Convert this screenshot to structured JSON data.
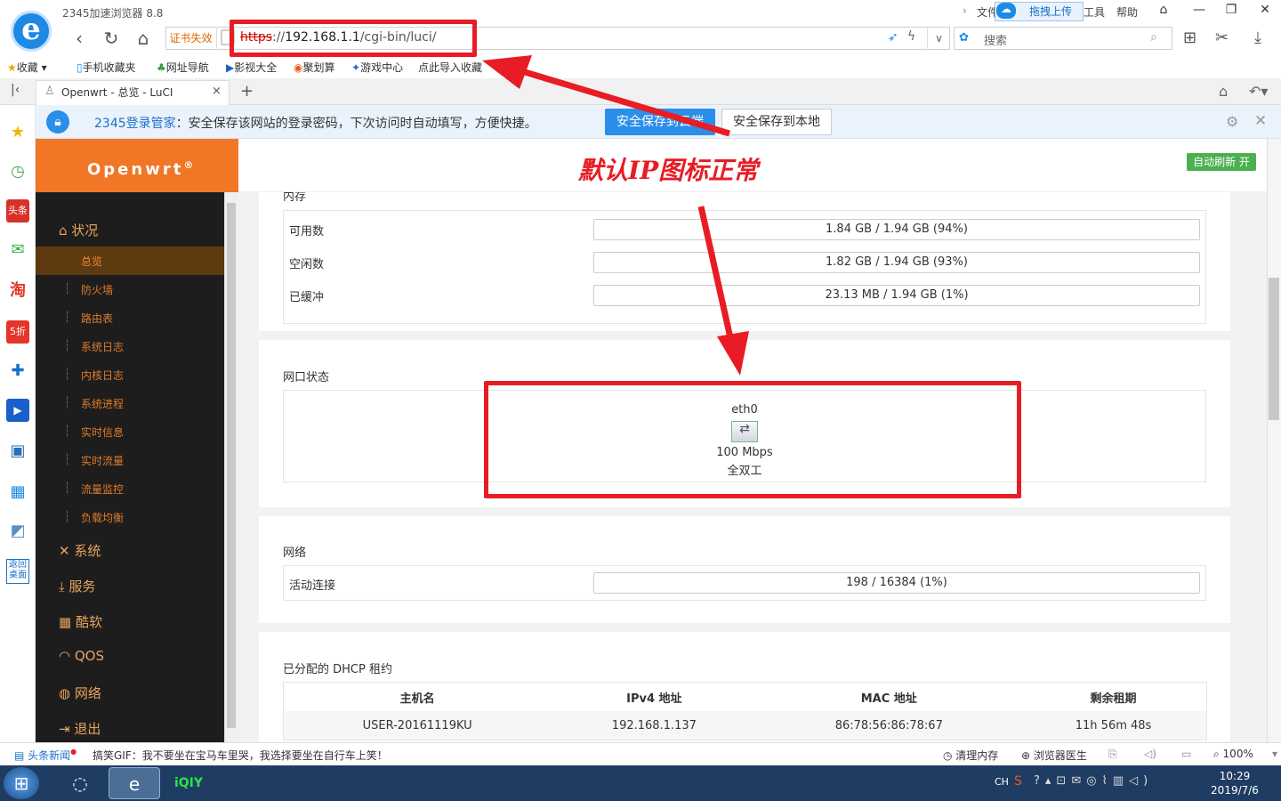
{
  "browser": {
    "title": "2345加速浏览器 8.8",
    "menu": {
      "file": "文件",
      "upload": "拖拽上传",
      "tools": "工具",
      "help": "帮助"
    },
    "cert_warning": "证书失效",
    "url_scheme": "https",
    "url_sep": "://",
    "url_host": "192.168.1.1",
    "url_path": "/cgi-bin/luci/",
    "search_placeholder": "搜索"
  },
  "bookmarks": [
    "收藏",
    "手机收藏夹",
    "网址导航",
    "影视大全",
    "聚划算",
    "游戏中心",
    "点此导入收藏"
  ],
  "tab": {
    "label": "Openwrt - 总览 - LuCI",
    "close": "×",
    "new": "+"
  },
  "password_bar": {
    "brand": "2345登录管家",
    "message": "：安全保存该网站的登录密码，下次访问时自动填写，方便快捷。",
    "save_cloud": "安全保存到云端",
    "save_local": "安全保存到本地"
  },
  "openwrt": {
    "logo": "Openwrt",
    "reg": "®",
    "auto_refresh": "自动刷新 开",
    "nav": {
      "status": "状况",
      "status_items": [
        "总览",
        "防火墙",
        "路由表",
        "系统日志",
        "内核日志",
        "系统进程",
        "实时信息",
        "实时流量",
        "流量监控",
        "负载均衡"
      ],
      "system": "系统",
      "services": "服务",
      "cool": "酷软",
      "qos": "QOS",
      "network": "网络",
      "logout": "退出"
    }
  },
  "memory": {
    "title": "内存",
    "rows": [
      {
        "label": "可用数",
        "value": "1.84 GB / 1.94 GB (94%)",
        "pct": 94
      },
      {
        "label": "空闲数",
        "value": "1.82 GB / 1.94 GB (93%)",
        "pct": 93
      },
      {
        "label": "已缓冲",
        "value": "23.13 MB / 1.94 GB (1%)",
        "pct": 1
      }
    ]
  },
  "ports": {
    "title": "网口状态",
    "iface": "eth0",
    "speed": "100 Mbps",
    "duplex": "全双工"
  },
  "network": {
    "title": "网络",
    "label": "活动连接",
    "value": "198 / 16384 (1%)",
    "pct": 1
  },
  "dhcp": {
    "title": "已分配的 DHCP 租约",
    "headers": [
      "主机名",
      "IPv4 地址",
      "MAC 地址",
      "剩余租期"
    ],
    "rows": [
      [
        "USER-20161119KU",
        "192.168.1.137",
        "86:78:56:86:78:67",
        "11h 56m 48s"
      ]
    ]
  },
  "annotation": "默认IP图标正常",
  "statusbar": {
    "news": "头条新闻",
    "ticker": "搞笑GIF：我不要坐在宝马车里哭，我选择要坐在自行车上笑！",
    "clean": "清理内存",
    "doctor": "浏览器医生",
    "zoom": "100%"
  },
  "taskbar": {
    "ime": "CH",
    "time": "10:29",
    "date": "2019/7/6"
  },
  "colors": {
    "annotation": "#e81c24",
    "openwrt_orange": "#f17626",
    "sidebar": "#1d1d1d"
  }
}
